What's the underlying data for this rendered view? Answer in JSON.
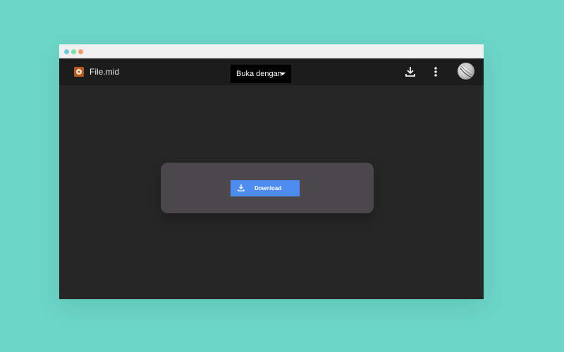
{
  "window": {
    "title_dots": [
      "red",
      "yellow",
      "green"
    ]
  },
  "topbar": {
    "file_name": "File.mid",
    "open_with_label": "Buka dengan",
    "download_icon": "download-icon",
    "more_icon": "more-vertical-icon",
    "avatar_icon": "avatar"
  },
  "content": {
    "download_label": "Download",
    "download_icon": "download-icon"
  },
  "colors": {
    "background": "#6bd5c7",
    "content": "#262626",
    "card": "#4a484b",
    "button": "#4e8cf0"
  }
}
